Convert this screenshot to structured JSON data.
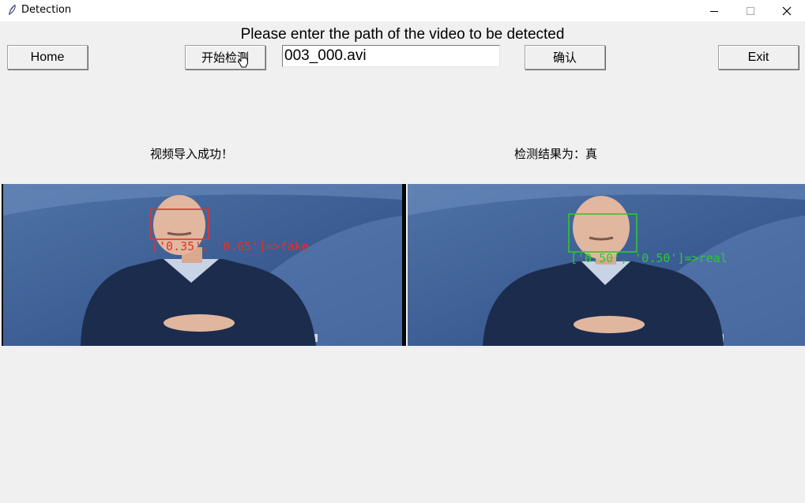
{
  "window": {
    "title": "Detection",
    "icon": "feather-icon"
  },
  "prompt": "Please enter the path of the video to be detected",
  "buttons": {
    "home": "Home",
    "start_detection": "开始检测",
    "confirm": "确认",
    "exit": "Exit"
  },
  "path_input": {
    "value": "003_000.avi"
  },
  "status": {
    "import_message": "视频导入成功！",
    "result_message": "检测结果为：真"
  },
  "frames": {
    "left": {
      "label": "['0.35', '0.65']=>fake",
      "box_color": "#e8302a"
    },
    "right": {
      "label": "['0.50', '0.50']=>real",
      "box_color": "#2ec831"
    }
  }
}
